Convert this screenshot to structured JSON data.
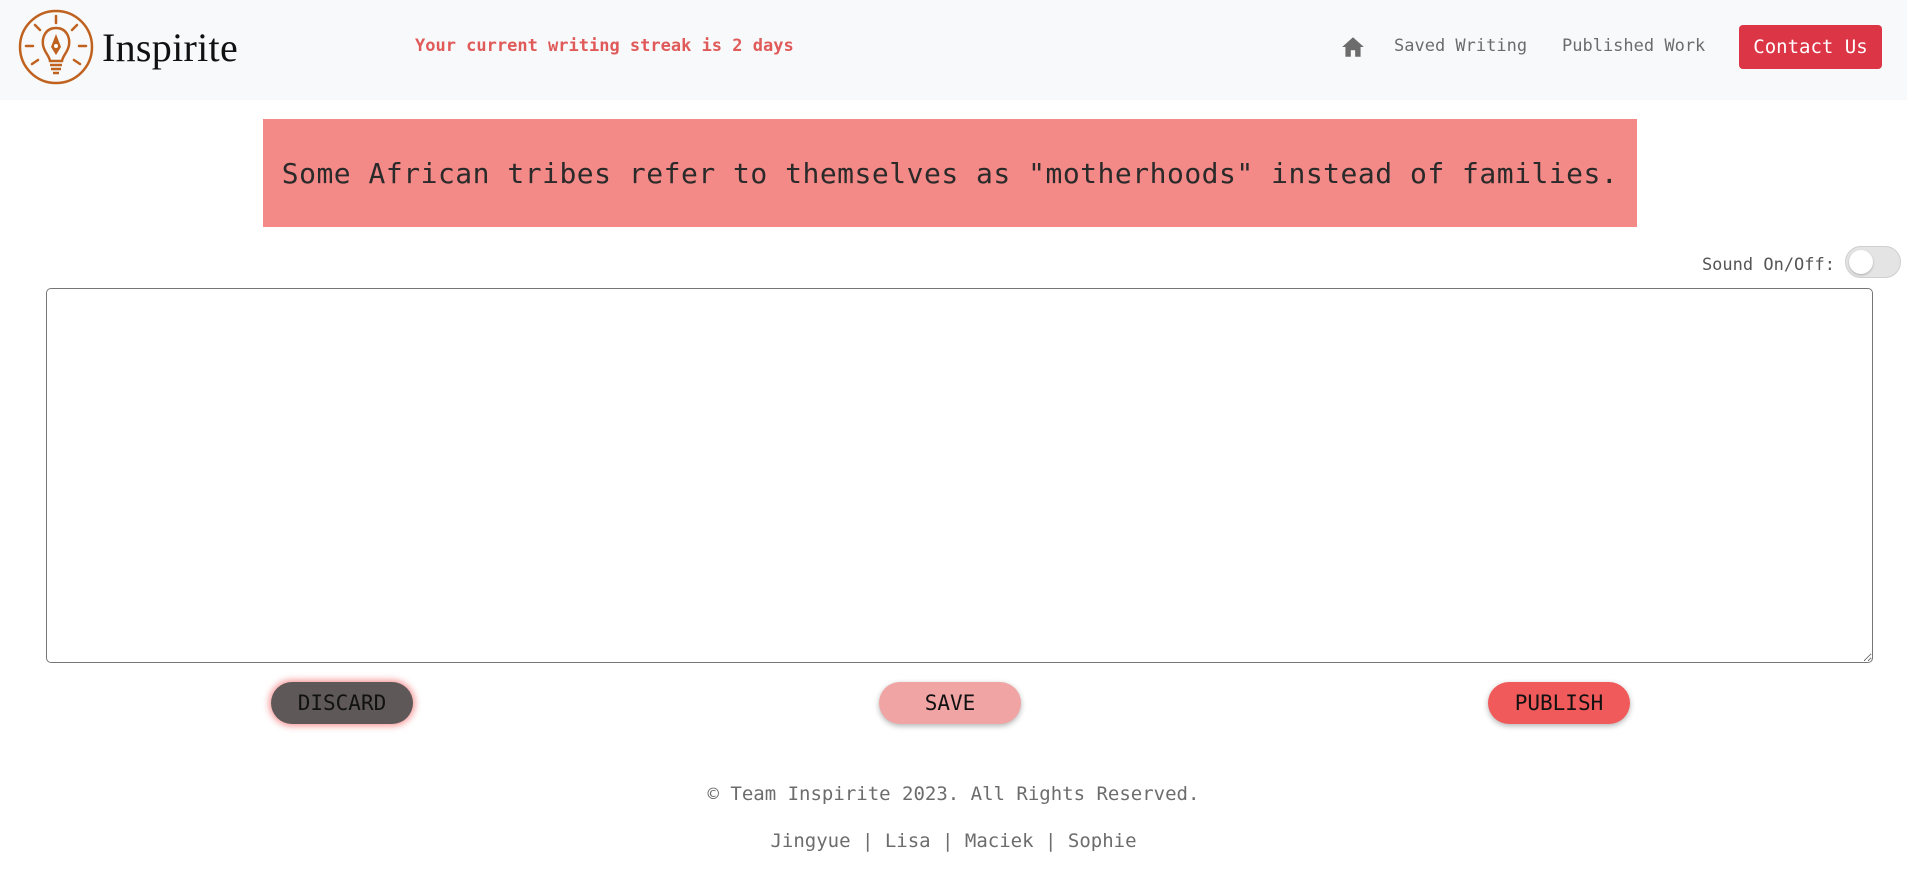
{
  "header": {
    "brand_name": "Inspirite",
    "logo_icon": "lightbulb-pen-logo",
    "streak_text": "Your current writing streak is 2 days",
    "nav": {
      "home_icon": "home-icon",
      "saved_label": "Saved Writing",
      "published_label": "Published Work",
      "contact_label": "Contact Us"
    }
  },
  "prompt": {
    "fact_text": "Some African tribes refer to themselves as \"motherhoods\" instead of families."
  },
  "sound": {
    "label": "Sound On/Off:",
    "enabled": false
  },
  "editor": {
    "value": ""
  },
  "actions": {
    "discard_label": "DISCARD",
    "save_label": "SAVE",
    "publish_label": "PUBLISH"
  },
  "footer": {
    "copyright": "© Team Inspirite 2023. All Rights Reserved.",
    "team": "Jingyue | Lisa | Maciek | Sophie"
  },
  "colors": {
    "accent_red": "#dc3545",
    "fact_bg": "#f48a88",
    "streak_text": "#e05a5a",
    "logo": "#c0621f"
  }
}
